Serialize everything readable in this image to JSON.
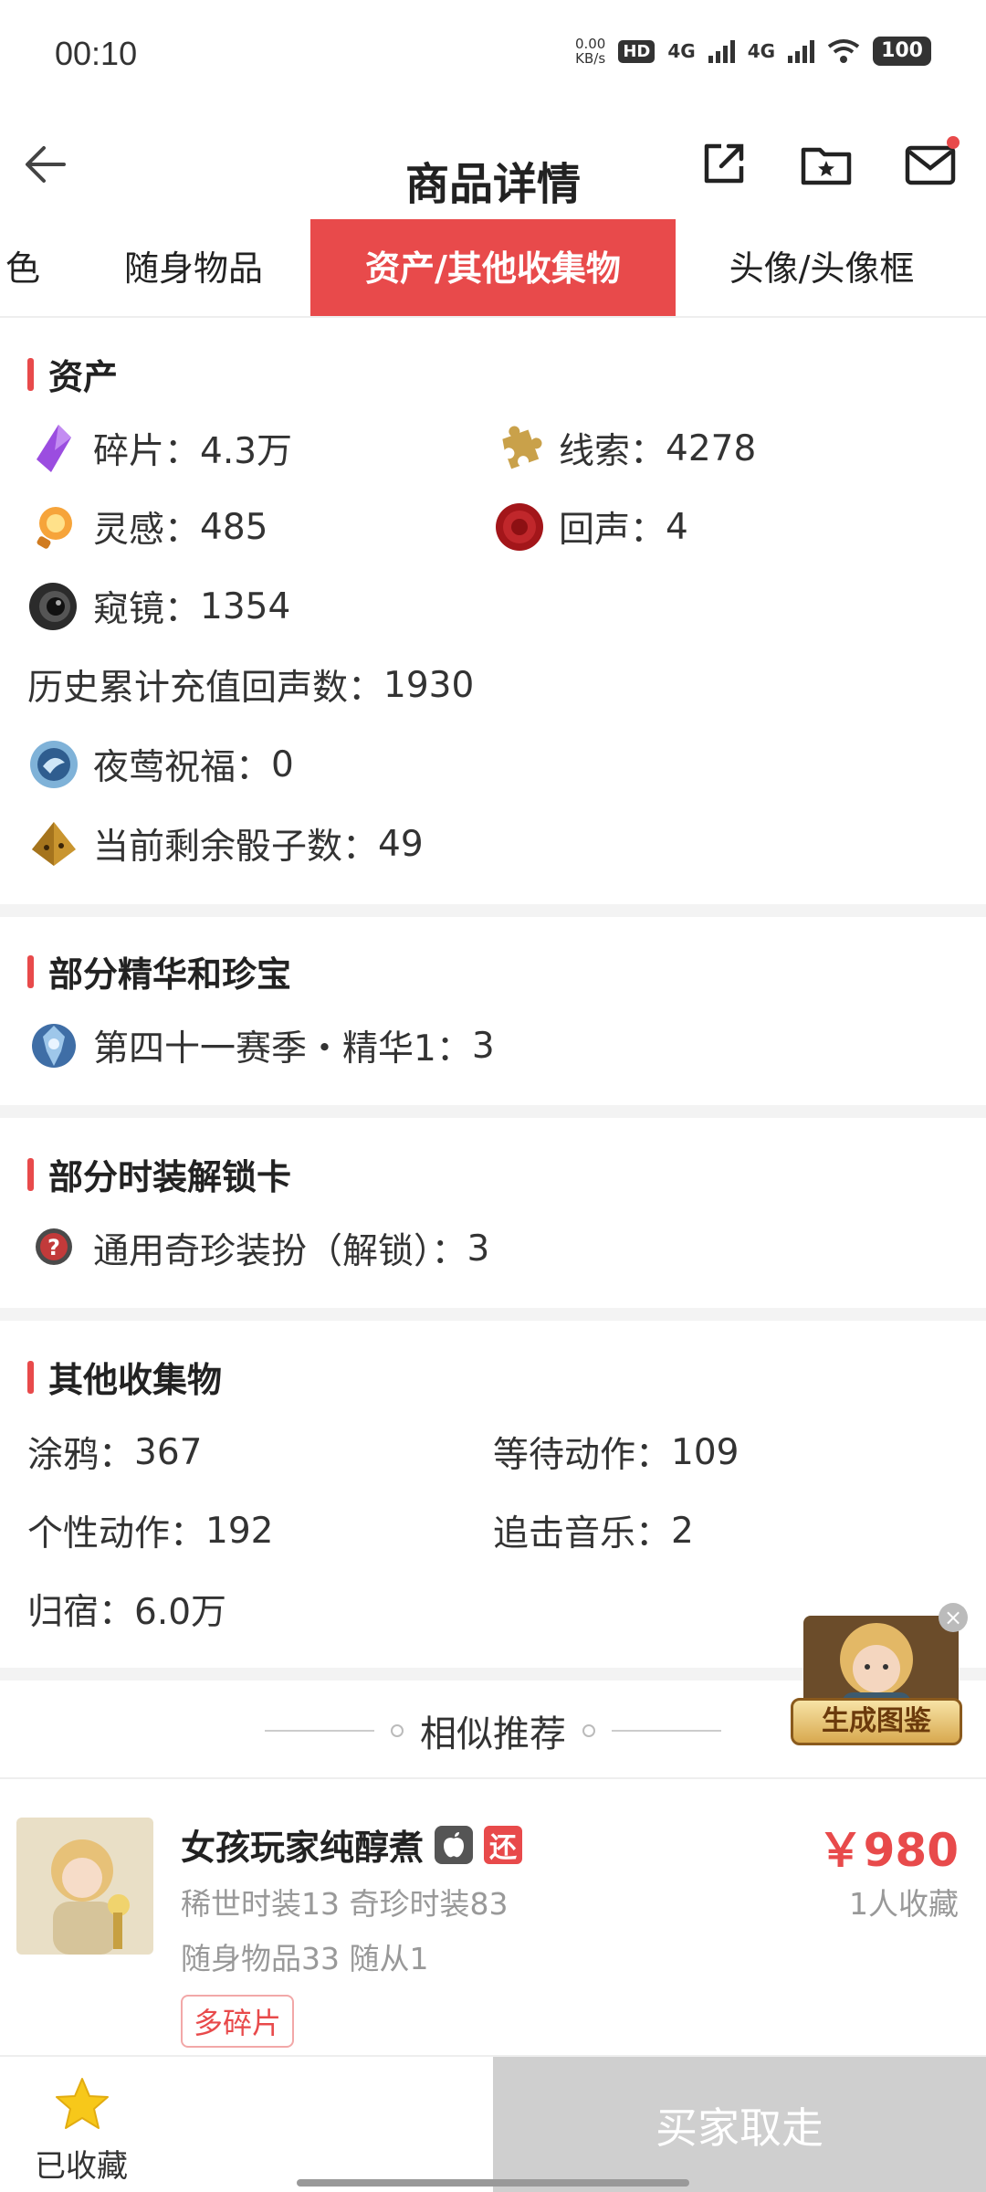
{
  "status_bar": {
    "time": "00:10",
    "net_speed_value": "0.00",
    "net_speed_unit": "KB/s",
    "hd_label": "HD",
    "sim1_label": "4G",
    "sim2_label": "4G",
    "battery": "100"
  },
  "header": {
    "title": "商品详情"
  },
  "tabs": [
    {
      "label": "色",
      "active": false
    },
    {
      "label": "随身物品",
      "active": false
    },
    {
      "label": "资产/其他收集物",
      "active": true
    },
    {
      "label": "头像/头像框",
      "active": false
    }
  ],
  "assets": {
    "title": "资产",
    "items": [
      {
        "icon": "crystal-shard-icon",
        "label": "碎片：",
        "value": "4.3万"
      },
      {
        "icon": "puzzle-clue-icon",
        "label": "线索：",
        "value": "4278"
      },
      {
        "icon": "inspiration-bulb-icon",
        "label": "灵感：",
        "value": "485"
      },
      {
        "icon": "echo-seal-icon",
        "label": "回声：",
        "value": "4"
      },
      {
        "icon": "lens-icon",
        "label": "窥镜：",
        "value": "1354"
      },
      {
        "icon": "",
        "label": "历史累计充值回声数：",
        "value": "1930"
      },
      {
        "icon": "nightingale-blessing-icon",
        "label": "夜莺祝福：",
        "value": "0"
      },
      {
        "icon": "dice-icon",
        "label": "当前剩余骰子数：",
        "value": "49"
      }
    ]
  },
  "essence": {
    "title": "部分精华和珍宝",
    "items": [
      {
        "icon": "essence-orb-icon",
        "label": "第四十一赛季・精华1：",
        "value": "3"
      }
    ]
  },
  "unlock_cards": {
    "title": "部分时装解锁卡",
    "items": [
      {
        "icon": "unlock-card-icon",
        "label": "通用奇珍装扮（解锁）：",
        "value": "3"
      }
    ]
  },
  "collectibles": {
    "title": "其他收集物",
    "items": [
      {
        "label": "涂鸦：",
        "value": "367"
      },
      {
        "label": "等待动作：",
        "value": "109"
      },
      {
        "label": "个性动作：",
        "value": "192"
      },
      {
        "label": "追击音乐：",
        "value": "2"
      },
      {
        "label": "归宿：",
        "value": "6.0万"
      }
    ]
  },
  "floating_widget": {
    "label": "生成图鉴"
  },
  "recommend": {
    "title": "相似推荐",
    "card": {
      "name": "女孩玩家纯醇煮",
      "return_badge": "还",
      "line1": "稀世时装13 奇珍时装83",
      "line2": "随身物品33 随从1",
      "tag": "多碎片",
      "price": "￥980",
      "favorites": "1人收藏"
    }
  },
  "bottom_bar": {
    "fav_label": "已收藏",
    "buy_label": "买家取走"
  },
  "colors": {
    "accent": "#e84a4b",
    "star": "#f7c81a",
    "buy_disabled": "#cfcfcf"
  }
}
